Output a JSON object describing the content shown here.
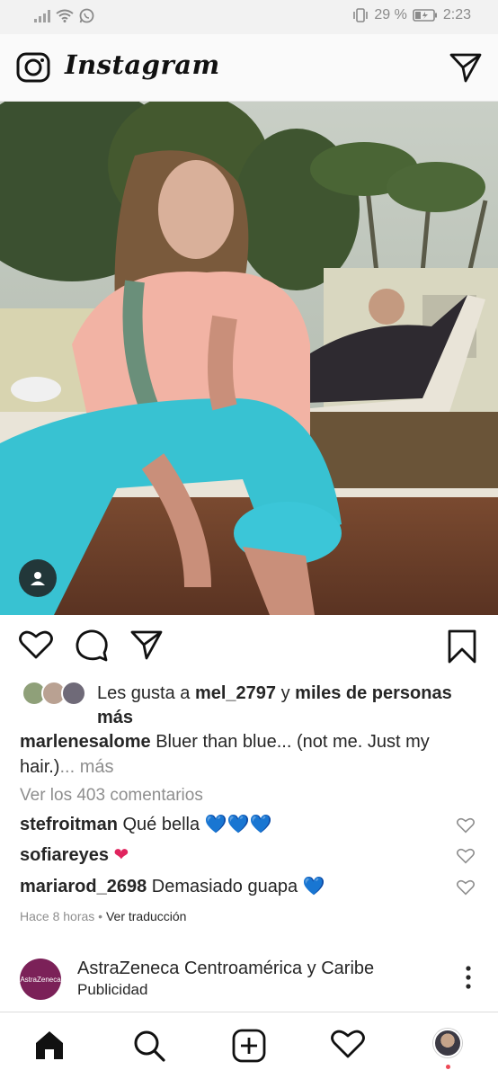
{
  "status_bar": {
    "battery_percent": "29 %",
    "time": "2:23"
  },
  "header": {
    "logo": "Instagram",
    "icons": [
      "camera-icon",
      "direct-message-icon"
    ]
  },
  "post": {
    "photo_icons": [
      "user-tag-icon"
    ],
    "actions": [
      "heart-icon",
      "comment-icon",
      "share-icon",
      "bookmark-icon"
    ],
    "likes": {
      "prefix": "Les gusta a ",
      "user": "mel_2797",
      "joiner": " y ",
      "rest": "miles de personas más"
    },
    "caption": {
      "user": "marlenesalome",
      "text": " Bluer than blue... (not me. Just my hair.)",
      "more": "... más"
    },
    "view_comments": "Ver los 403 comentarios",
    "comments": [
      {
        "user": "stefroitman",
        "text": " Qué bella ",
        "emoji": "💙💙💙"
      },
      {
        "user": "sofiareyes",
        "text": " ",
        "emoji": "❤"
      },
      {
        "user": "mariarod_2698",
        "text": " Demasiado guapa ",
        "emoji": "💙"
      }
    ],
    "time_ago": "Hace 8 horas",
    "separator": " • ",
    "translate": "Ver traducción"
  },
  "ad": {
    "logo_text": "AstraZeneca",
    "name": "AstraZeneca Centroamérica y Caribe",
    "sponsored": "Publicidad"
  },
  "bottom_nav": {
    "items": [
      "home-icon",
      "search-icon",
      "new-post-icon",
      "activity-icon",
      "profile-icon"
    ],
    "accent": "#ed4956"
  },
  "colors": {
    "text": "#262626",
    "muted": "#8e8e8e",
    "blue_heart": "#2f7fd8",
    "red_heart": "#e0245e"
  }
}
